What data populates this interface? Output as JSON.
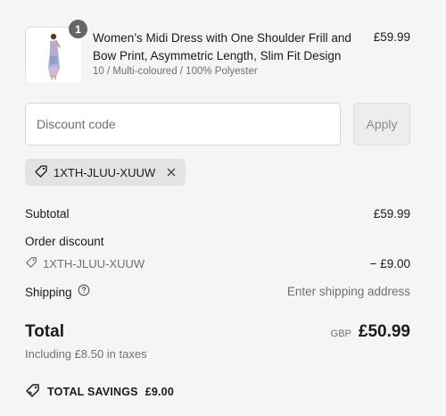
{
  "product": {
    "quantity": "1",
    "title": "Women’s Midi Dress with One Shoulder Frill and Bow Print, Asymmetric Length, Slim Fit Design",
    "variant": "10 / Multi-coloured / 100% Polyester",
    "price": "£59.99",
    "image_icon": "dress-product-thumbnail"
  },
  "discount": {
    "placeholder": "Discount code",
    "value": "",
    "apply_label": "Apply",
    "applied_code": "1XTH-JLUU-XUUW"
  },
  "summary": {
    "subtotal_label": "Subtotal",
    "subtotal_value": "£59.99",
    "order_discount_label": "Order discount",
    "order_discount_code": "1XTH-JLUU-XUUW",
    "order_discount_value": "− £9.00",
    "shipping_label": "Shipping",
    "shipping_value": "Enter shipping address",
    "total_label": "Total",
    "currency": "GBP",
    "total_value": "£50.99",
    "taxes_note": "Including £8.50 in taxes",
    "savings_label": "TOTAL SAVINGS",
    "savings_value": "£9.00"
  },
  "colors": {
    "background": "#f5f5f5",
    "text": "#1a1a1a",
    "muted": "#707070",
    "chip": "#e3e3e3",
    "badge": "#666666"
  }
}
